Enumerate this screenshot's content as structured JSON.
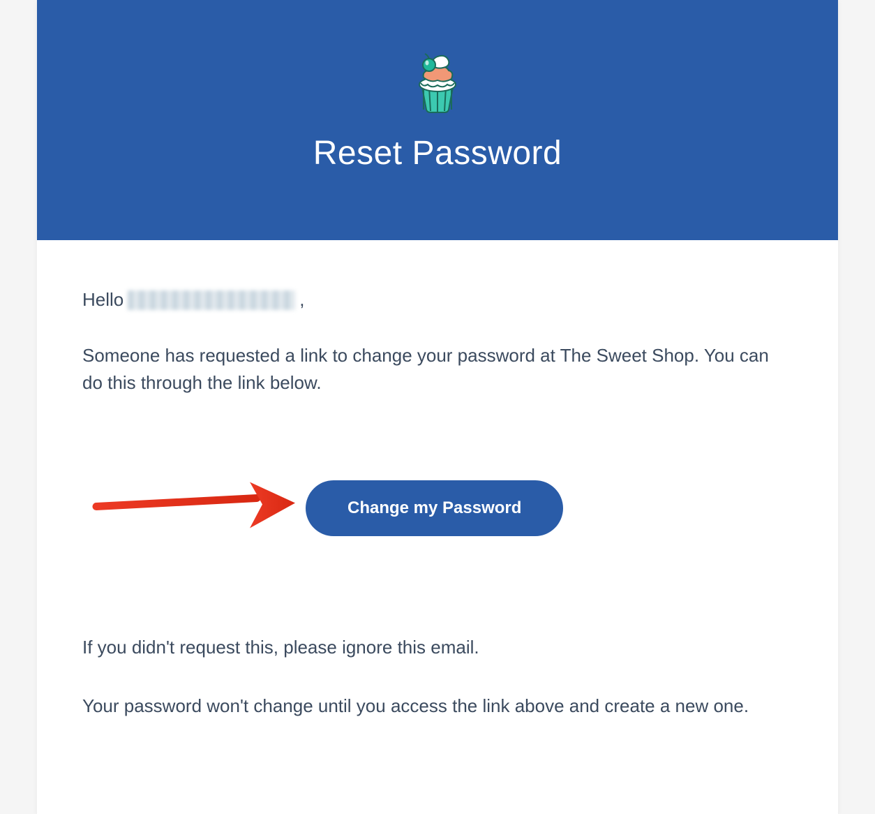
{
  "header": {
    "title": "Reset Password"
  },
  "body": {
    "greeting_prefix": "Hello",
    "greeting_suffix": ",",
    "message": "Someone has requested a link to change your password at The Sweet Shop. You can do this through the link below.",
    "cta_label": "Change my Password",
    "ignore_text": "If you didn't request this, please ignore this email.",
    "footer_text": "Your password won't change until you access the link above and create a new one."
  },
  "colors": {
    "brand": "#2a5ca8",
    "text": "#3b4a5e",
    "arrow": "#ec3a24"
  }
}
